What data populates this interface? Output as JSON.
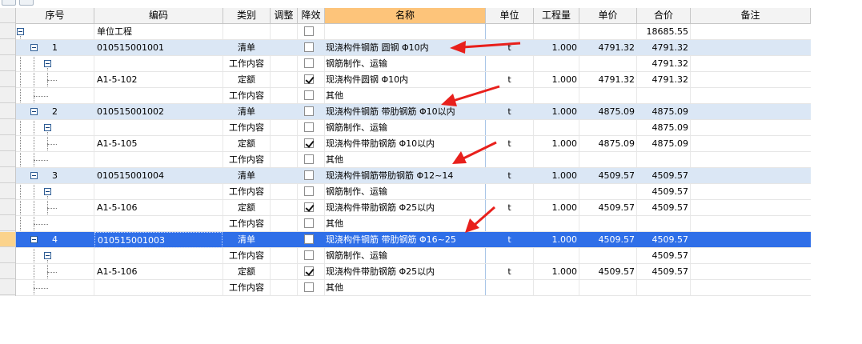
{
  "columns": [
    "序号",
    "编码",
    "类别",
    "调整",
    "降效",
    "名称",
    "单位",
    "工程量",
    "单价",
    "合价",
    "备注"
  ],
  "rows": [
    {
      "idx": "",
      "code": "单位工程",
      "type": "",
      "checked": false,
      "name": "",
      "unit": "",
      "qty": "",
      "price": "",
      "total": "18685.55"
    },
    {
      "idx": "1",
      "code": "010515001001",
      "type": "清单",
      "checked": false,
      "name": "现浇构件钢筋 圆钢 Φ10内",
      "unit": "t",
      "qty": "1.000",
      "price": "4791.32",
      "total": "4791.32"
    },
    {
      "idx": "",
      "code": "",
      "type": "工作内容",
      "checked": false,
      "name": "钢筋制作、运输",
      "unit": "",
      "qty": "",
      "price": "",
      "total": "4791.32"
    },
    {
      "idx": "",
      "code": "A1-5-102",
      "type": "定额",
      "checked": true,
      "name": "现浇构件圆钢 Φ10内",
      "unit": "t",
      "qty": "1.000",
      "price": "4791.32",
      "total": "4791.32"
    },
    {
      "idx": "",
      "code": "",
      "type": "工作内容",
      "checked": false,
      "name": "其他",
      "unit": "",
      "qty": "",
      "price": "",
      "total": ""
    },
    {
      "idx": "2",
      "code": "010515001002",
      "type": "清单",
      "checked": false,
      "name": "现浇构件钢筋 带肋钢筋 Φ10以内",
      "unit": "t",
      "qty": "1.000",
      "price": "4875.09",
      "total": "4875.09"
    },
    {
      "idx": "",
      "code": "",
      "type": "工作内容",
      "checked": false,
      "name": "钢筋制作、运输",
      "unit": "",
      "qty": "",
      "price": "",
      "total": "4875.09"
    },
    {
      "idx": "",
      "code": "A1-5-105",
      "type": "定额",
      "checked": true,
      "name": "现浇构件带肋钢筋 Φ10以内",
      "unit": "t",
      "qty": "1.000",
      "price": "4875.09",
      "total": "4875.09"
    },
    {
      "idx": "",
      "code": "",
      "type": "工作内容",
      "checked": false,
      "name": "其他",
      "unit": "",
      "qty": "",
      "price": "",
      "total": ""
    },
    {
      "idx": "3",
      "code": "010515001004",
      "type": "清单",
      "checked": false,
      "name": "现浇构件钢筋带肋钢筋 Φ12~14",
      "unit": "t",
      "qty": "1.000",
      "price": "4509.57",
      "total": "4509.57"
    },
    {
      "idx": "",
      "code": "",
      "type": "工作内容",
      "checked": false,
      "name": "钢筋制作、运输",
      "unit": "",
      "qty": "",
      "price": "",
      "total": "4509.57"
    },
    {
      "idx": "",
      "code": "A1-5-106",
      "type": "定额",
      "checked": true,
      "name": "现浇构件带肋钢筋 Φ25以内",
      "unit": "t",
      "qty": "1.000",
      "price": "4509.57",
      "total": "4509.57"
    },
    {
      "idx": "",
      "code": "",
      "type": "工作内容",
      "checked": false,
      "name": "其他",
      "unit": "",
      "qty": "",
      "price": "",
      "total": ""
    },
    {
      "idx": "4",
      "code": "010515001003",
      "type": "清单",
      "checked": false,
      "name": "现浇构件钢筋 带肋钢筋 Φ16~25",
      "unit": "t",
      "qty": "1.000",
      "price": "4509.57",
      "total": "4509.57"
    },
    {
      "idx": "",
      "code": "",
      "type": "工作内容",
      "checked": false,
      "name": "钢筋制作、运输",
      "unit": "",
      "qty": "",
      "price": "",
      "total": "4509.57"
    },
    {
      "idx": "",
      "code": "A1-5-106",
      "type": "定额",
      "checked": true,
      "name": "现浇构件带肋钢筋 Φ25以内",
      "unit": "t",
      "qty": "1.000",
      "price": "4509.57",
      "total": "4509.57"
    },
    {
      "idx": "",
      "code": "",
      "type": "工作内容",
      "checked": false,
      "name": "其他",
      "unit": "",
      "qty": "",
      "price": "",
      "total": ""
    }
  ],
  "colors": {
    "selected_row": "#2f6fe8",
    "list_row": "#dbe7f5",
    "header_highlight": "#fdc47a",
    "annotation_arrow": "#e8201c"
  }
}
